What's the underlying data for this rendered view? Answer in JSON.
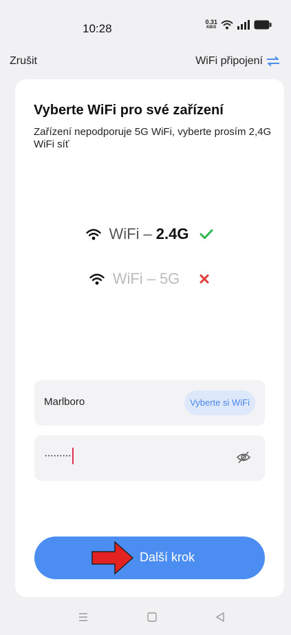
{
  "status_bar": {
    "time": "10:28",
    "net_speed_value": "0.31",
    "net_speed_unit": "KB/S"
  },
  "topbar": {
    "cancel_label": "Zrušit",
    "wifi_connection_label": "WiFi připojení"
  },
  "card": {
    "title": "Vyberte WiFi pro své zařízení",
    "description": "Zařízení nepodporuje 5G WiFi, vyberte prosím 2,4G WiFi síť"
  },
  "bands": [
    {
      "name": "WiFi",
      "separator": "–",
      "freq": "2.4G",
      "supported": true
    },
    {
      "name": "WiFi",
      "separator": "–",
      "freq": "5G",
      "supported": false
    }
  ],
  "form": {
    "ssid_value": "Marlboro",
    "choose_wifi_label": "Vyberte si WiFi",
    "password_masked": "·········"
  },
  "next_button_label": "Další krok",
  "colors": {
    "accent": "#4b8df0",
    "check": "#2db84d",
    "cross": "#e03a3a",
    "arrow": "#e52222"
  }
}
